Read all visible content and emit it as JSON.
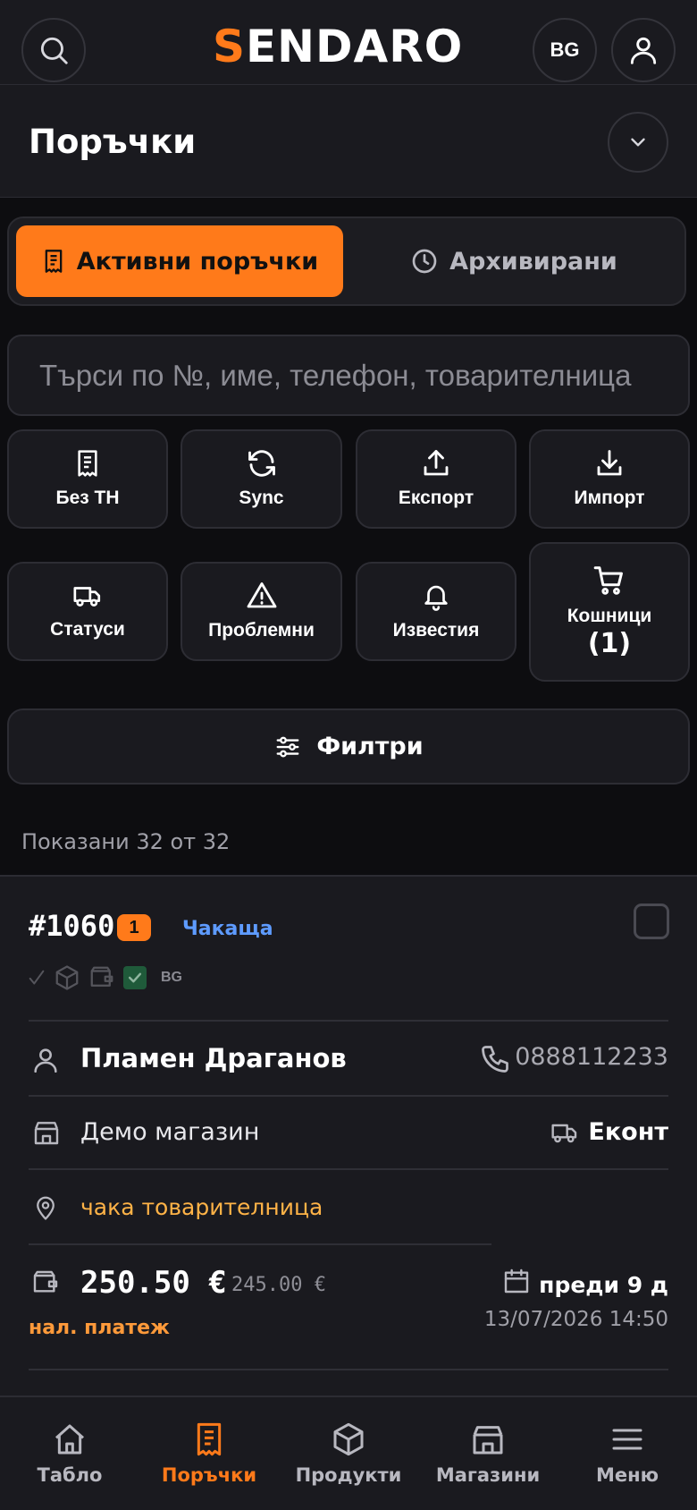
{
  "header": {
    "brand": {
      "first_letter": "S",
      "rest": "ENDARO"
    },
    "language": "BG"
  },
  "page": {
    "title": "Поръчки"
  },
  "tabs": [
    {
      "label": "Активни поръчки",
      "icon": "receipt-icon",
      "active": true
    },
    {
      "label": "Архивирани",
      "icon": "clock-icon",
      "active": false
    }
  ],
  "search": {
    "placeholder": "Търси по №, име, телефон, товарителница"
  },
  "actions": [
    {
      "label": "Без ТН",
      "icon": "receipt-icon"
    },
    {
      "label": "Sync",
      "icon": "refresh-icon"
    },
    {
      "label": "Експорт",
      "icon": "upload-icon"
    },
    {
      "label": "Импорт",
      "icon": "download-icon"
    },
    {
      "label": "Статуси",
      "icon": "truck-icon"
    },
    {
      "label": "Проблемни",
      "icon": "warning-icon"
    },
    {
      "label": "Известия",
      "icon": "bell-icon"
    },
    {
      "label": "Кошници",
      "count": "(1)",
      "icon": "cart-icon"
    }
  ],
  "filters": {
    "label": "Филтри"
  },
  "results": {
    "text": "Показани 32 от 32"
  },
  "order": {
    "number": "#1060",
    "badge": "1",
    "status": "Чакаща",
    "status_color": "#5e9bff",
    "country": "BG",
    "customer": "Пламен Драганов",
    "phone": "0888112233",
    "shop": "Демо магазин",
    "courier": "Еконт",
    "awb_status": "чака товарителница",
    "total": "250.50 €",
    "subtotal": "245.00 €",
    "payment_method": "нал. платеж",
    "relative_time": "преди 9 д",
    "date": "13/07/2026 14:50"
  },
  "bottom_nav": [
    {
      "label": "Табло",
      "icon": "home-icon",
      "active": false
    },
    {
      "label": "Поръчки",
      "icon": "receipt-icon",
      "active": true
    },
    {
      "label": "Продукти",
      "icon": "box-icon",
      "active": false
    },
    {
      "label": "Магазини",
      "icon": "store-icon",
      "active": false
    },
    {
      "label": "Меню",
      "icon": "menu-icon",
      "active": false
    }
  ],
  "colors": {
    "accent": "#ff7a1a",
    "background": "#0d0d10",
    "surface": "#1a1a1f"
  }
}
